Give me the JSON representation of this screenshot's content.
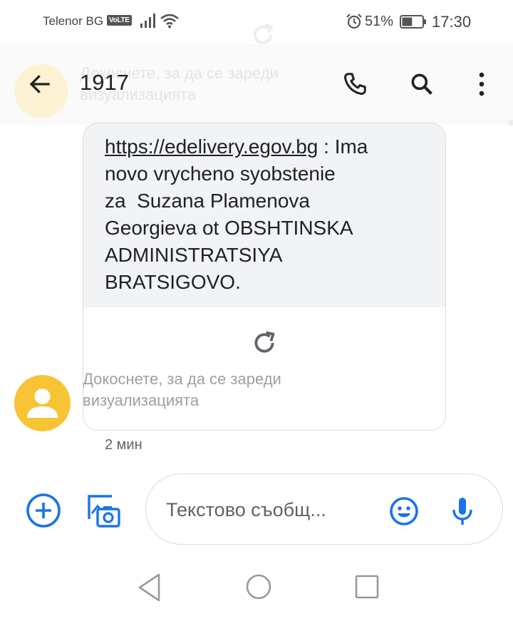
{
  "status_bar": {
    "carrier": "Telenor BG",
    "volte": "VoLTE",
    "battery_percent": "51%",
    "battery_level": 0.51,
    "time": "17:30"
  },
  "ghost": {
    "text_line1": "Докоснете, за да се зареди",
    "text_line2": "визуализацията"
  },
  "toolbar": {
    "title": "1917",
    "icons": [
      "arrow-left-icon",
      "phone-icon",
      "search-icon",
      "more-vert-icon"
    ]
  },
  "message": {
    "link": "https://edelivery.egov.bg",
    "line1_rest": " : Ima",
    "line2": "novo vrycheno syobstenie",
    "line3": "za  Suzana Plamenova",
    "line4": "Georgieva ot OBSHTINSKA",
    "line5": "ADMINISTRATSIYA",
    "line6": "BRATSIGOVO.",
    "preview_caption_line1": "Докоснете, за да се зареди",
    "preview_caption_line2": "визуализацията",
    "timestamp": "2 мин"
  },
  "compose": {
    "placeholder": "Текстово съобщ..."
  },
  "colors": {
    "accent": "#1a73e8",
    "avatar": "#f6c435",
    "bubble": "#f1f3f4",
    "secondary_text": "#5f6368"
  }
}
